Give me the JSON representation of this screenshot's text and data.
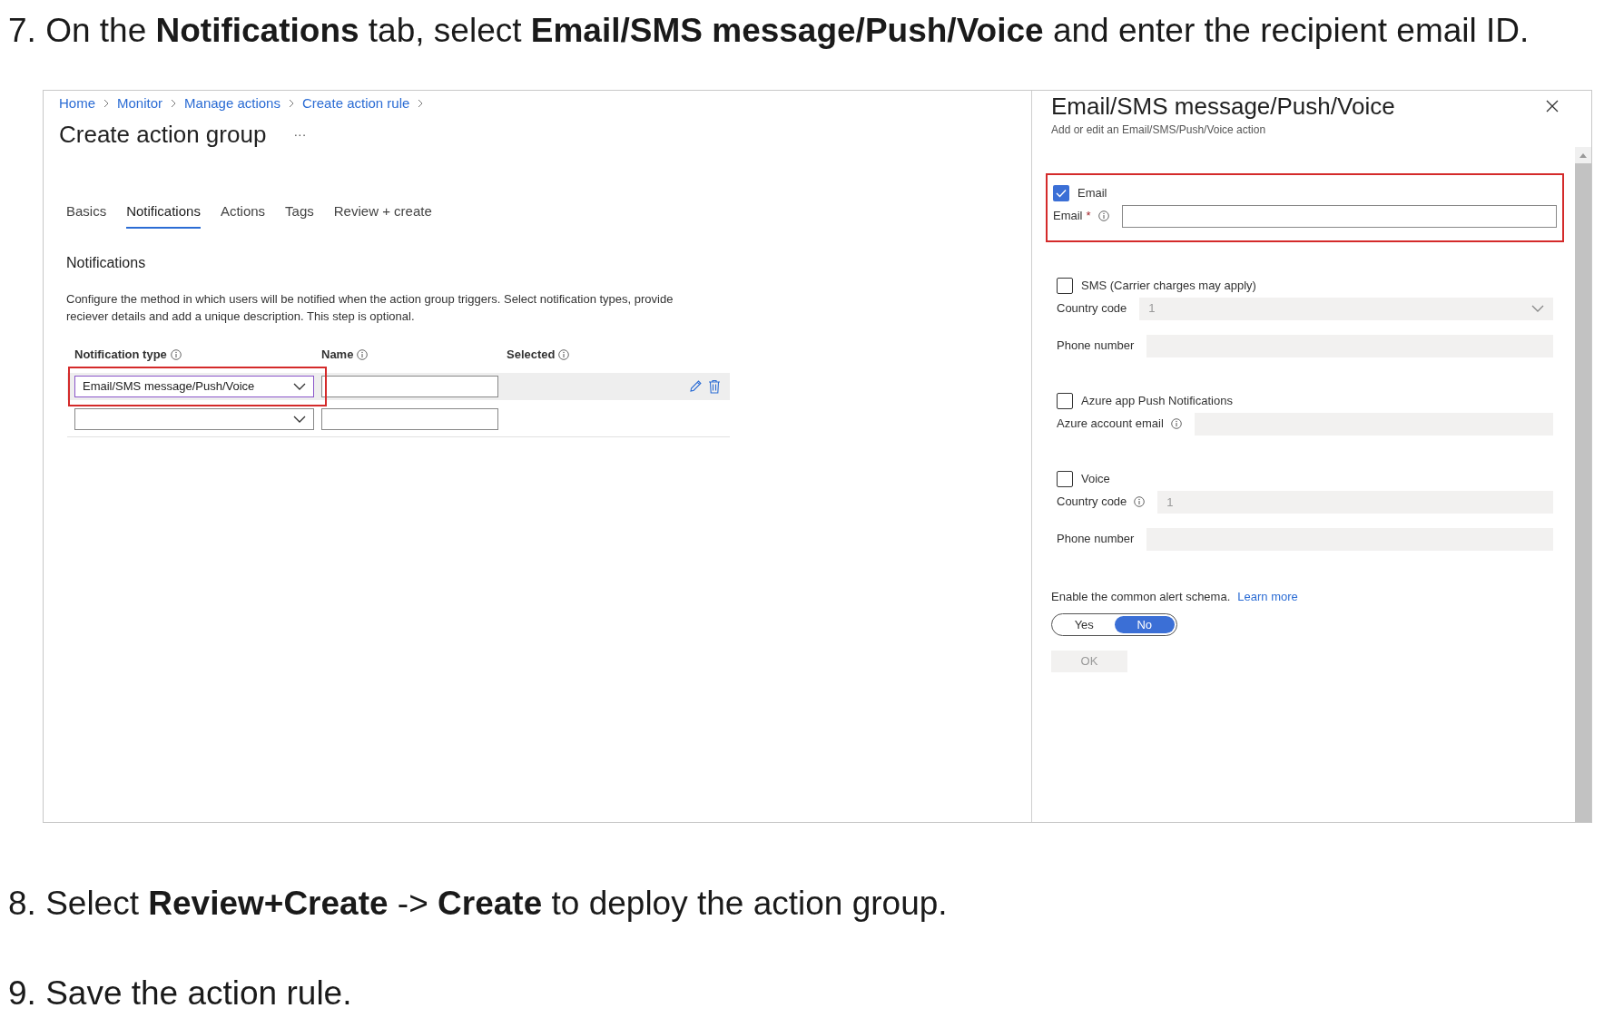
{
  "steps": [
    {
      "text": "7. On the **Notifications** tab, select **Email/SMS message/Push/Voice** and enter the recipient email ID."
    },
    {
      "text": "8. Select **Review+Create** -> **Create** to deploy the action group."
    },
    {
      "text": "9. Save the action rule."
    }
  ],
  "screenshot": {
    "breadcrumb": [
      "Home",
      "Monitor",
      "Manage actions",
      "Create action rule"
    ],
    "title": "Create action group",
    "more": "···",
    "tabs": [
      {
        "label": "Basics",
        "selected": false
      },
      {
        "label": "Notifications",
        "selected": true
      },
      {
        "label": "Actions",
        "selected": false
      },
      {
        "label": "Tags",
        "selected": false
      },
      {
        "label": "Review + create",
        "selected": false
      }
    ],
    "section_heading": "Notifications",
    "description": "Configure the method in which users will be notified when the action group triggers. Select notification types, provide reciever details and add a unique description. This step is optional.",
    "table": {
      "columns": [
        "Notification type",
        "Name",
        "Selected"
      ],
      "rows": [
        {
          "notification_type": "Email/SMS message/Push/Voice",
          "selected": true,
          "callout": true
        },
        {
          "selected": false,
          "callout": false
        }
      ]
    },
    "panel": {
      "title": "Email/SMS message/Push/Voice",
      "subtitle": "Add or edit an Email/SMS/Push/Voice action",
      "groups": [
        {
          "label": "Email",
          "checked": true,
          "callout": true,
          "fields": [
            {
              "label": "Email",
              "required_mark": "*",
              "info": true,
              "kind": "text",
              "disabled": false
            }
          ]
        },
        {
          "label": "SMS (Carrier charges may apply)",
          "checked": false,
          "callout": false,
          "fields": [
            {
              "label": "Country code",
              "info": false,
              "kind": "select",
              "value": "1",
              "disabled": true
            },
            {
              "label": "Phone number",
              "info": false,
              "kind": "text",
              "disabled": true
            }
          ]
        },
        {
          "label": "Azure app Push Notifications",
          "checked": false,
          "callout": false,
          "fields": [
            {
              "label": "Azure account email",
              "info": true,
              "kind": "text",
              "disabled": true
            }
          ]
        },
        {
          "label": "Voice",
          "checked": false,
          "callout": false,
          "fields": [
            {
              "label": "Country code",
              "info": true,
              "kind": "text",
              "value": "1",
              "disabled": true
            },
            {
              "label": "Phone number",
              "info": false,
              "kind": "text",
              "disabled": true
            }
          ]
        }
      ],
      "schema_label": "Enable the common alert schema.",
      "schema_link": "Learn more",
      "toggle": [
        {
          "label": "Yes",
          "selected": false
        },
        {
          "label": "No",
          "selected": true
        }
      ],
      "ok_button": {
        "label": "OK",
        "disabled": true
      }
    }
  }
}
